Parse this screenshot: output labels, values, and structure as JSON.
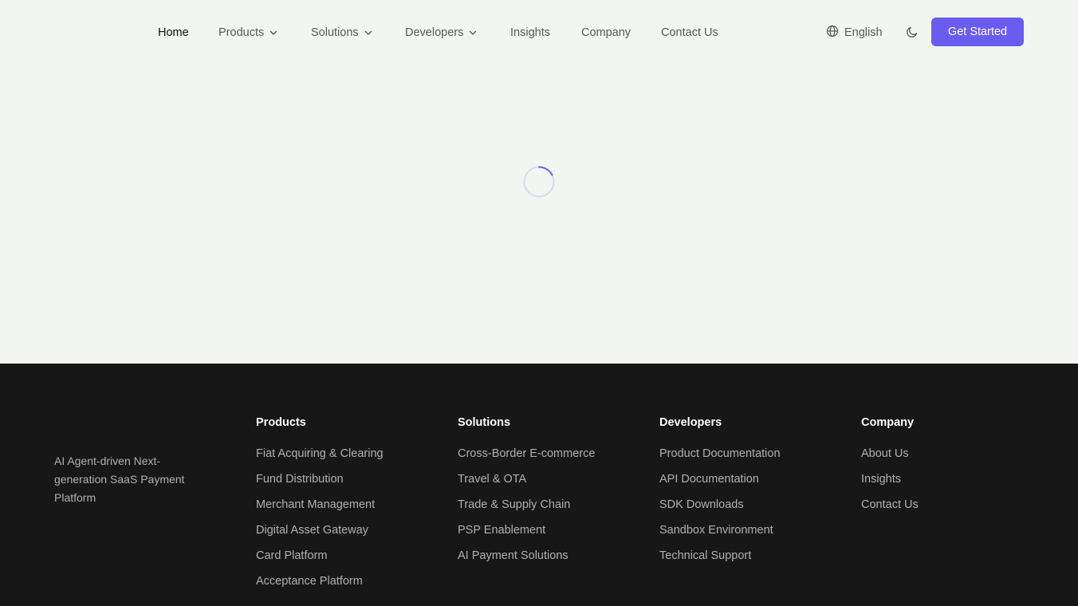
{
  "header": {
    "nav": [
      {
        "label": "Home",
        "dropdown": false,
        "active": true
      },
      {
        "label": "Products",
        "dropdown": true,
        "active": false
      },
      {
        "label": "Solutions",
        "dropdown": true,
        "active": false
      },
      {
        "label": "Developers",
        "dropdown": true,
        "active": false
      },
      {
        "label": "Insights",
        "dropdown": false,
        "active": false
      },
      {
        "label": "Company",
        "dropdown": false,
        "active": false
      },
      {
        "label": "Contact Us",
        "dropdown": false,
        "active": false
      }
    ],
    "language": "English",
    "language_icon": "globe-icon",
    "theme_icon": "moon-icon",
    "cta_label": "Get Started"
  },
  "colors": {
    "accent": "#6b5cf0",
    "page_bg": "#f3f5f0",
    "footer_bg": "#171717"
  },
  "footer": {
    "tagline": "AI Agent-driven Next-generation SaaS Payment Platform",
    "columns": [
      {
        "title": "Products",
        "links": [
          "Fiat Acquiring & Clearing",
          "Fund Distribution",
          "Merchant Management",
          "Digital Asset Gateway",
          "Card Platform",
          "Acceptance Platform"
        ]
      },
      {
        "title": "Solutions",
        "links": [
          "Cross-Border E-commerce",
          "Travel & OTA",
          "Trade & Supply Chain",
          "PSP Enablement",
          "AI Payment Solutions"
        ]
      },
      {
        "title": "Developers",
        "links": [
          "Product Documentation",
          "API Documentation",
          "SDK Downloads",
          "Sandbox Environment",
          "Technical Support"
        ]
      },
      {
        "title": "Company",
        "links": [
          "About Us",
          "Insights",
          "Contact Us"
        ]
      }
    ]
  }
}
